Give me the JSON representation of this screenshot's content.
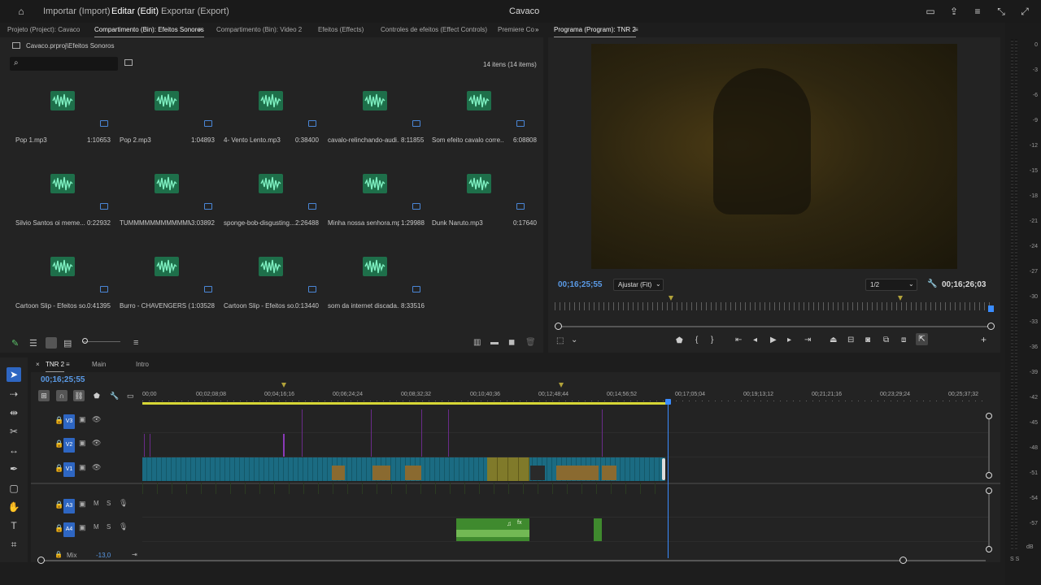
{
  "menu": {
    "import": "Importar (Import)",
    "edit": "Editar (Edit)",
    "export": "Exportar (Export)",
    "title": "Cavaco"
  },
  "tabs": {
    "project": "Projeto (Project): Cavaco",
    "bin_sounds": "Compartimento (Bin): Efeitos Sonoros",
    "bin_video2": "Compartimento (Bin): Video 2",
    "effects": "Efeitos (Effects)",
    "effect_controls": "Controles de efeitos (Effect Controls)",
    "premiere": "Premiere Co",
    "program": "Programa (Program): TNR 2"
  },
  "bin": {
    "path": "Cavaco.prproj\\Efeitos Sonoros",
    "search_placeholder": "",
    "count": "14 itens (14 items)",
    "items": [
      {
        "name": "Pop 1.mp3",
        "dur": "1:10653"
      },
      {
        "name": "Pop 2.mp3",
        "dur": "1:04893"
      },
      {
        "name": "4- Vento Lento.mp3",
        "dur": "0:38400"
      },
      {
        "name": "cavalo-relinchando-audi...",
        "dur": "8:11855"
      },
      {
        "name": "Som efeito cavalo corre...",
        "dur": "6:08808"
      },
      {
        "name": "Silvio Santos oi meme...",
        "dur": "0:22932"
      },
      {
        "name": "TUMMMMMMMMMMMM...",
        "dur": "3:03892"
      },
      {
        "name": "sponge-bob-disgusting...",
        "dur": "2:26488"
      },
      {
        "name": "Minha nossa senhora.mp3",
        "dur": "1:29988"
      },
      {
        "name": "Dunk Naruto.mp3",
        "dur": "0:17640"
      },
      {
        "name": "Cartoon Slip - Efeitos so...",
        "dur": "0:41395"
      },
      {
        "name": "Burro - CHAVENGERS (...",
        "dur": "1:03528"
      },
      {
        "name": "Cartoon Slip - Efeitos so...",
        "dur": "0:13440"
      },
      {
        "name": "som da internet discada...",
        "dur": "8:33516"
      }
    ]
  },
  "program": {
    "tc_current": "00;16;25;55",
    "fit": "Ajustar (Fit)",
    "resolution": "1/2",
    "tc_total": "00;16;26;03"
  },
  "meter": {
    "labels": [
      "0",
      "-3",
      "-6",
      "-9",
      "-12",
      "-15",
      "-18",
      "-21",
      "-24",
      "-27",
      "-30",
      "-33",
      "-36",
      "-39",
      "-42",
      "-45",
      "-48",
      "-51",
      "-54",
      "-57"
    ],
    "db": "dB",
    "solo": "S S"
  },
  "timeline": {
    "tabs": [
      "TNR 2",
      "Main",
      "Intro"
    ],
    "tc": "00;16;25;55",
    "ruler": [
      "00;00",
      "00;02;08;08",
      "00;04;16;16",
      "00;06;24;24",
      "00;08;32;32",
      "00;10;40;36",
      "00;12;48;44",
      "00;14;56;52",
      "00;17;05;04",
      "00;19;13;12",
      "00;21;21;16",
      "00;23;29;24",
      "00;25;37;32"
    ],
    "tracks": {
      "v3": "V3",
      "v2": "V2",
      "v1": "V1",
      "a3": "A3",
      "a4": "A4",
      "mix": "Mix",
      "mix_val": "-13,0",
      "m": "M",
      "s": "S"
    }
  },
  "colors": {
    "accent": "#2e66c2",
    "tc_blue": "#5a9ae6",
    "clip_video": "#1b6b82",
    "clip_audio": "#3f8a2e",
    "clip_yellow": "#807a2a",
    "playhead": "#3a8cff"
  }
}
